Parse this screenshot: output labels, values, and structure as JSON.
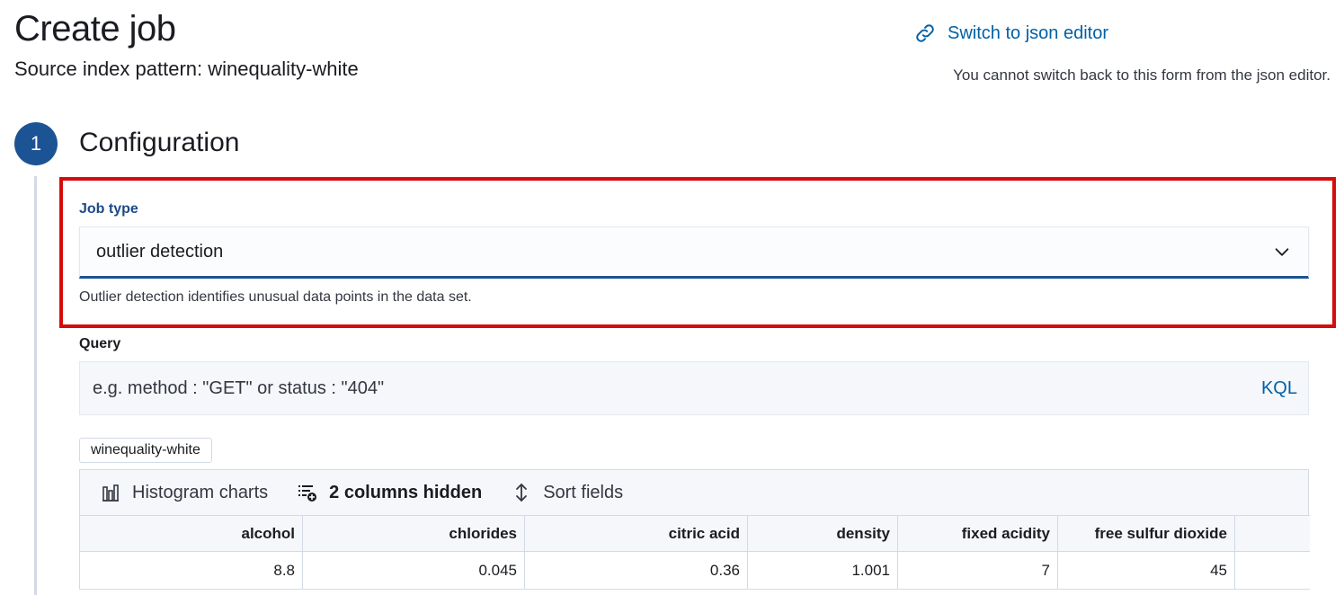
{
  "header": {
    "title": "Create job",
    "subtitle": "Source index pattern: winequality-white",
    "switch_label": "Switch to json editor",
    "switch_icon": "link-icon",
    "switch_note": "You cannot switch back to this form from the json editor."
  },
  "step": {
    "number": "1",
    "title": "Configuration"
  },
  "job_type": {
    "label": "Job type",
    "value": "outlier detection",
    "help": "Outlier detection identifies unusual data points in the data set."
  },
  "query": {
    "label": "Query",
    "placeholder": "e.g. method : \"GET\" or status : \"404\"",
    "language": "KQL"
  },
  "index_badge": "winequality-white",
  "toolbar": {
    "histogram_label": "Histogram charts",
    "columns_hidden_label": "2 columns hidden",
    "sort_label": "Sort fields"
  },
  "table": {
    "columns": [
      "alcohol",
      "chlorides",
      "citric acid",
      "density",
      "fixed acidity",
      "free sulfur dioxide"
    ],
    "rows": [
      [
        "8.8",
        "0.045",
        "0.36",
        "1.001",
        "7",
        "45"
      ]
    ]
  },
  "colors": {
    "accent": "#1c5394",
    "link": "#0061a6",
    "highlight": "#d60c0c"
  }
}
